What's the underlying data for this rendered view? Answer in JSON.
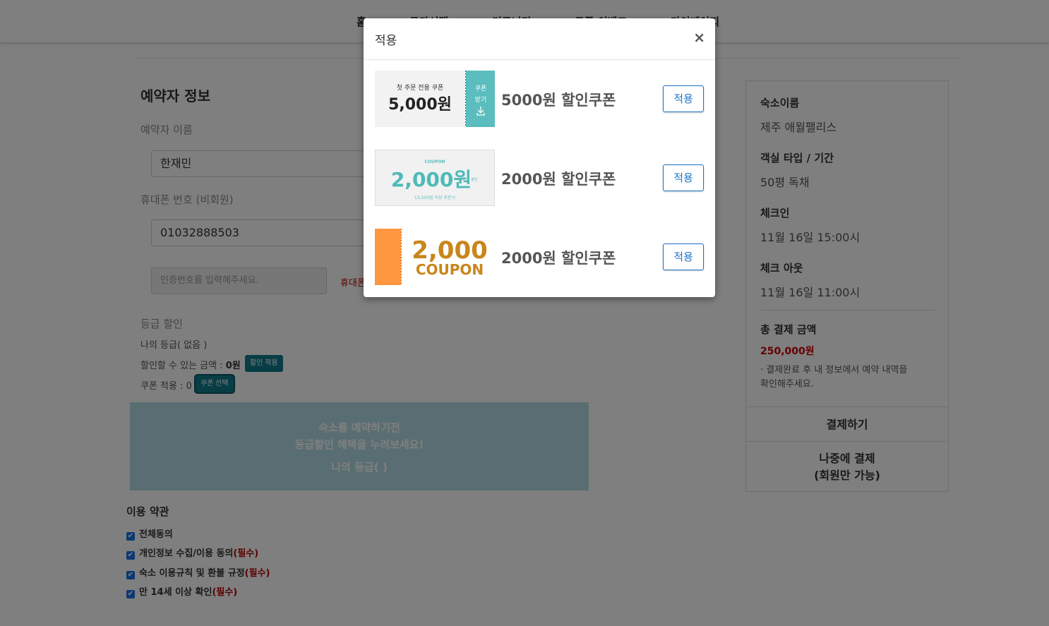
{
  "nav": {
    "items": [
      "홈",
      "국가선택",
      "커뮤니티",
      "쿠폰 이벤트",
      "마이페이지"
    ]
  },
  "booker": {
    "title": "예약자 정보",
    "name_label": "예약자 이름",
    "name_value": "한재민",
    "phone_label": "휴대폰 번호 (비회원)",
    "phone_value": "01032888503",
    "verify_placeholder": "인증번호를 입력해주세요.",
    "verify_link": "휴대폰"
  },
  "discount": {
    "title": "등급 할인",
    "my_grade": "나의 등급( 없음 )",
    "amount_label": "할인할 수 있는 금액 : ",
    "amount_value": "0원",
    "apply_label": "할인 적용",
    "coupon_label": "쿠폰 적용 : 0",
    "coupon_select": "쿠폰 선택"
  },
  "banner": {
    "line1": "숙소를 예약하기전",
    "line2": "등급할인 혜택을 누려보세요!",
    "line3": "나의 등급( )"
  },
  "terms": {
    "title": "이용 약관",
    "items": [
      {
        "text": "전체동의",
        "req": ""
      },
      {
        "text": "개인정보 수집/이용 동의",
        "req": "(필수)"
      },
      {
        "text": "숙소 이용규칙 및 환불 규정",
        "req": "(필수)"
      },
      {
        "text": "만 14세 이상 확인",
        "req": "(필수)"
      }
    ]
  },
  "summary": {
    "stay_label": "숙소이름",
    "stay_value": "제주 애월팰리스",
    "room_label": "객실 타입 / 기간",
    "room_value": "50평 독채",
    "checkin_label": "체크인",
    "checkin_value": "11월 16일 15:00시",
    "checkout_label": "체크 아웃",
    "checkout_value": "11월 16일 11:00시",
    "total_label": "총 결제 금액",
    "total_value": "250,000원",
    "note": "· 결제완료 후 내 정보에서 예약 내역을 확인해주세요.",
    "pay_button": "결제하기",
    "later_line1": "나중에 결제",
    "later_line2": "(회원만 가능)"
  },
  "modal": {
    "title": "적용",
    "close": "×",
    "coupons": [
      {
        "name": "5000원 할인쿠폰",
        "apply": "적용",
        "img_top": "첫 주문 전용 쿠폰",
        "img_amount": "5,000원",
        "img_tab1": "쿠폰",
        "img_tab2": "받기"
      },
      {
        "name": "2000원 할인쿠폰",
        "apply": "적용",
        "img_top": "COUPON",
        "img_amount": "2,000원",
        "img_side": "할인",
        "img_bottom": "13,500원 이상 주문시"
      },
      {
        "name": "2000원 할인쿠폰",
        "apply": "적용",
        "img_amount": "2,000",
        "img_sub": "COUPON"
      }
    ]
  },
  "colors": {
    "teal": "#117a8b",
    "coupon_teal": "#5bbdbd",
    "coupon_orange": "#ff9640",
    "coupon_gold": "#c8861b",
    "apply_blue": "#1a73c8",
    "required_red": "#b00000"
  }
}
